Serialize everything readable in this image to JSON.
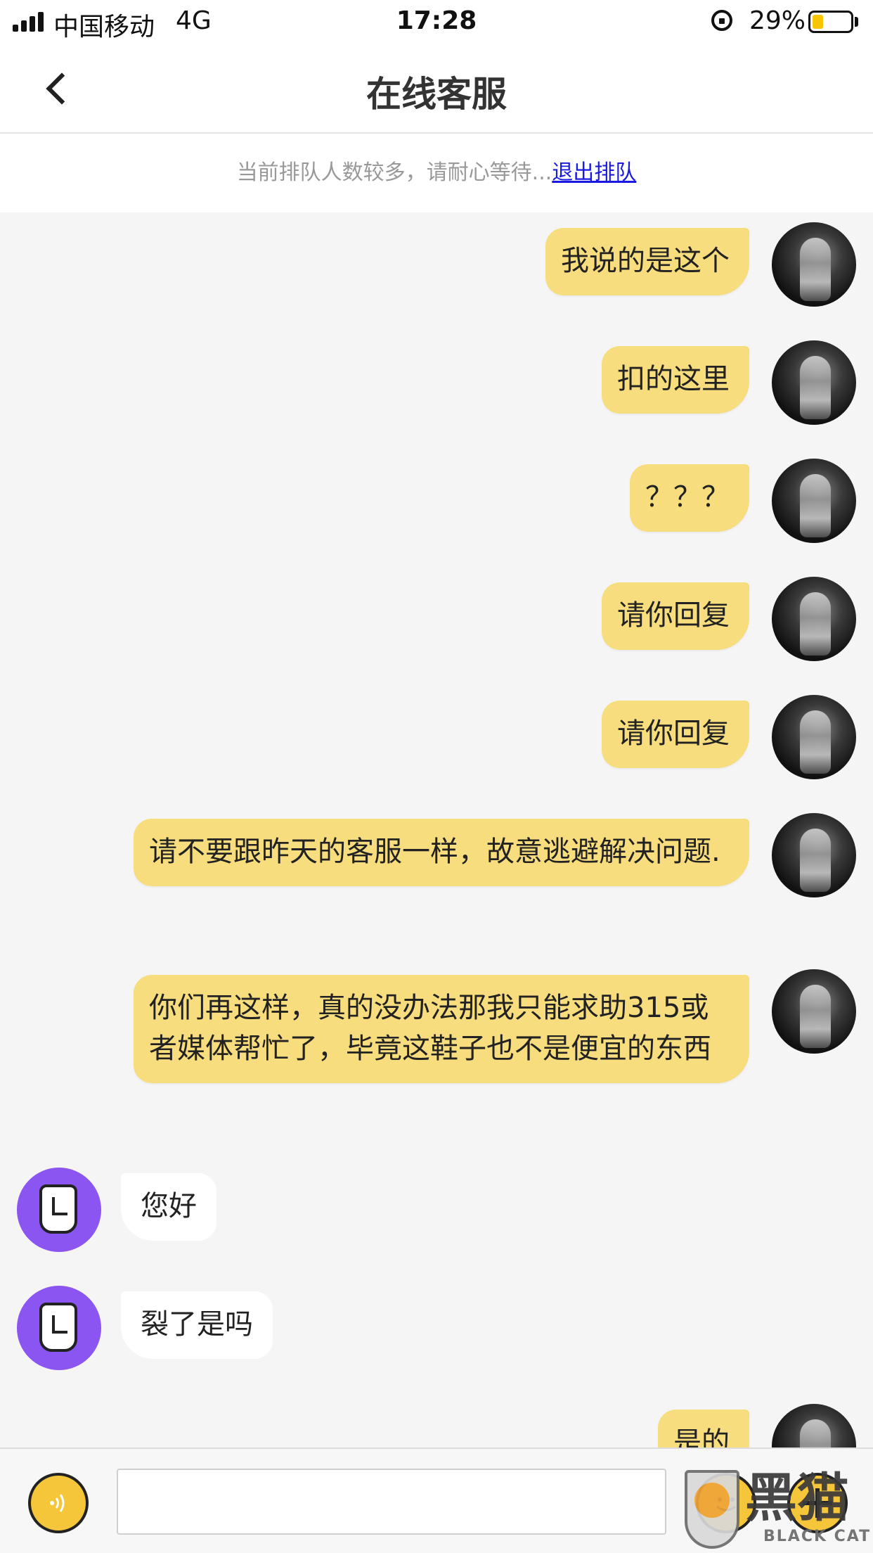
{
  "status_bar": {
    "carrier": "中国移动",
    "network": "4G",
    "time": "17:28",
    "battery_percent": "29%",
    "battery_level": 0.29,
    "battery_color": "#f7c600"
  },
  "header": {
    "title": "在线客服",
    "back_icon": "chevron-left-icon"
  },
  "queue_notice": {
    "text": "当前排队人数较多，请耐心等待...",
    "exit_link": "退出排队"
  },
  "messages": [
    {
      "sender": "user",
      "text": "我说的是这个"
    },
    {
      "sender": "user",
      "text": "扣的这里"
    },
    {
      "sender": "user",
      "text": "？？？"
    },
    {
      "sender": "user",
      "text": "请你回复"
    },
    {
      "sender": "user",
      "text": "请你回复"
    },
    {
      "sender": "user",
      "text": "请不要跟昨天的客服一样，故意逃避解决问题."
    },
    {
      "sender": "user",
      "text": "你们再这样，真的没办法那我只能求助315或者媒体帮忙了，毕竟这鞋子也不是便宜的东西"
    },
    {
      "sender": "agent",
      "text": "您好"
    },
    {
      "sender": "agent",
      "text": "裂了是吗"
    },
    {
      "sender": "user",
      "text": "是的"
    }
  ],
  "input_bar": {
    "voice_icon": "voice-icon",
    "input_value": "",
    "emoji_icon": "emoji-icon",
    "plus_icon": "plus-icon"
  },
  "watermark": {
    "text": "黑猫",
    "subtext": "BLACK CAT"
  },
  "colors": {
    "user_bubble": "#f8dd7e",
    "agent_bubble": "#ffffff",
    "agent_avatar": "#8a55f0",
    "link": "#1a1ae0",
    "background": "#f5f5f5"
  }
}
